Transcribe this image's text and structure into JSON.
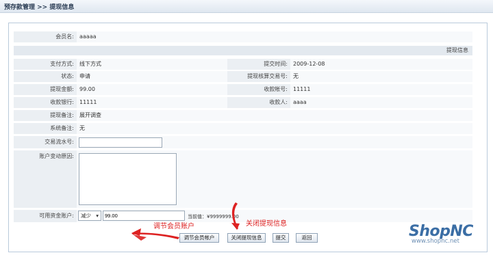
{
  "breadcrumb": "预存款管理 >> 提现信息",
  "member": {
    "label": "会员名:",
    "value": "aaaaa"
  },
  "section_title": "提现信息",
  "fields": {
    "pay_method": {
      "label": "支付方式:",
      "value": "线下方式"
    },
    "submit_time": {
      "label": "提交时间:",
      "value": "2009-12-08"
    },
    "status": {
      "label": "状态:",
      "value": "申请"
    },
    "verify_no": {
      "label": "提现核算交易号:",
      "value": "无"
    },
    "amount": {
      "label": "提现金额:",
      "value": "99.00"
    },
    "account_no": {
      "label": "收款帐号:",
      "value": "11111"
    },
    "bank": {
      "label": "收款银行:",
      "value": "11111"
    },
    "payee": {
      "label": "收款人:",
      "value": "aaaa"
    },
    "remark": {
      "label": "提现备注:",
      "value": "展开调查"
    },
    "sys_remark": {
      "label": "系统备注:",
      "value": "无"
    },
    "txn_no": {
      "label": "交易流水号:",
      "value": ""
    },
    "change_reason": {
      "label": "账户变动原因:",
      "value": ""
    },
    "available": {
      "label": "可用资金账户:",
      "op_selected": "减少",
      "amount_value": "99.00",
      "current_prefix": "当前值：¥",
      "current_value": "9999999.00"
    }
  },
  "buttons": {
    "adjust": "调节会员帐户",
    "close": "关闭提现信息",
    "submit": "提交",
    "back": "返回"
  },
  "annotations": {
    "adjust": "调节会员账户",
    "close": "关闭提现信息"
  },
  "logo": {
    "name": "ShopNC",
    "url": "www.shopnc.net"
  },
  "colors": {
    "annotation": "#dd2222",
    "logo": "#3b6ea5"
  }
}
